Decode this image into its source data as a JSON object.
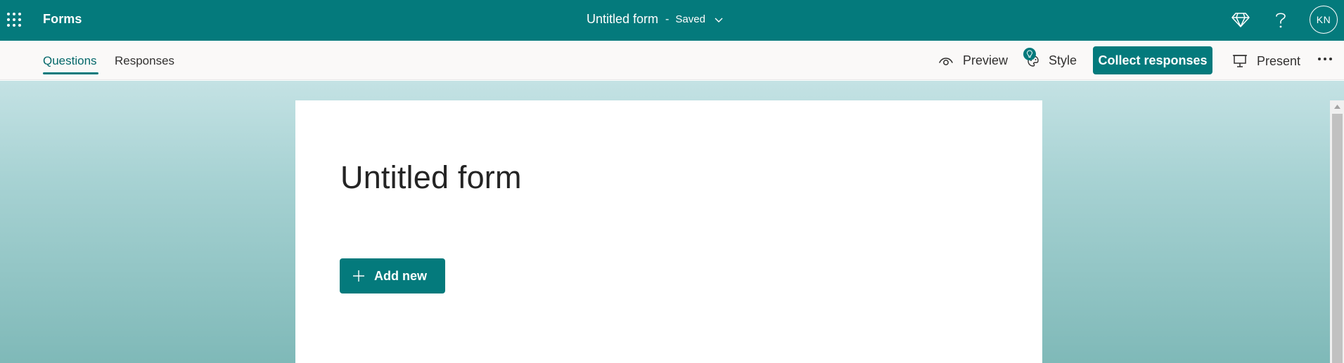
{
  "colors": {
    "brand": "#047a7c",
    "tab_active": "#04686a"
  },
  "topbar": {
    "app_name": "Forms",
    "form_title": "Untitled form",
    "separator": "-",
    "save_status": "Saved",
    "icons": [
      "app-launcher-icon",
      "diamond-icon",
      "help-icon"
    ],
    "avatar_initials": "KN"
  },
  "tabs": [
    {
      "label": "Questions",
      "active": true
    },
    {
      "label": "Responses",
      "active": false
    }
  ],
  "actions": {
    "preview_label": "Preview",
    "style_label": "Style",
    "collect_label": "Collect responses",
    "present_label": "Present"
  },
  "form": {
    "title": "Untitled form",
    "add_new_label": "Add new"
  }
}
